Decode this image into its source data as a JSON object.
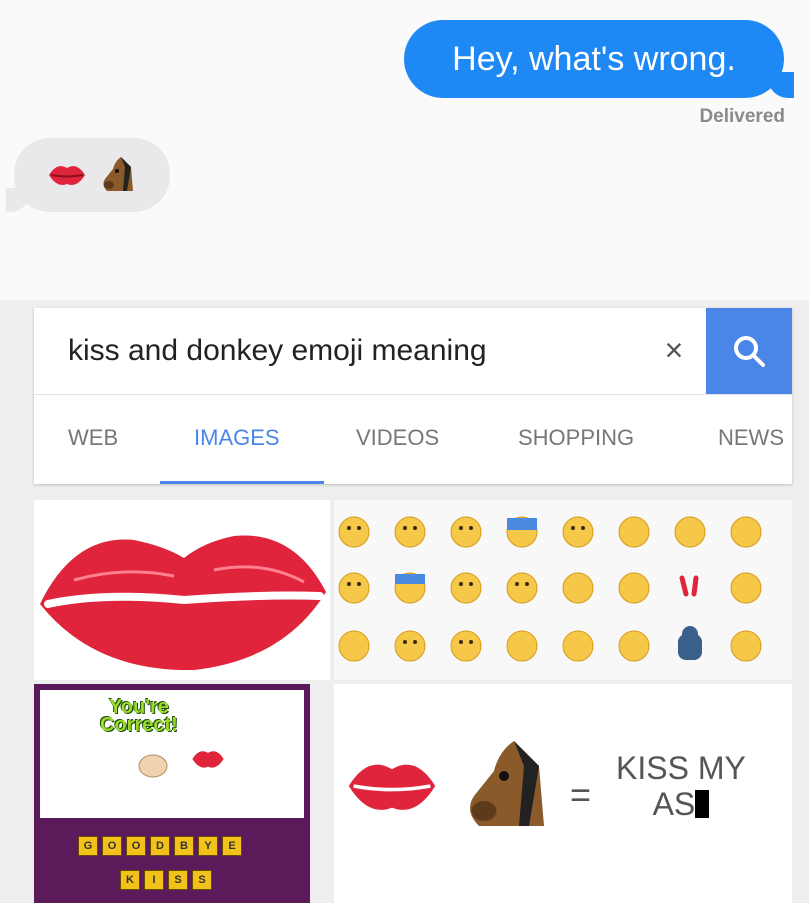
{
  "messages": {
    "outgoing_text": "Hey, what's wrong.",
    "delivered_label": "Delivered",
    "incoming_emojis": [
      "kiss-mark",
      "horse-face"
    ]
  },
  "search": {
    "query": "kiss and donkey emoji meaning",
    "clear_label": "×",
    "tabs": [
      "WEB",
      "IMAGES",
      "VIDEOS",
      "SHOPPING",
      "NEWS"
    ],
    "active_tab": "IMAGES"
  },
  "results": {
    "game_title_line1": "You're",
    "game_title_line2": "Correct!",
    "game_tiles_row1": [
      "G",
      "O",
      "O",
      "D",
      "B",
      "Y",
      "E"
    ],
    "game_tiles_row2": [
      "K",
      "I",
      "S",
      "S"
    ],
    "equation_equals": "=",
    "equation_text_line1": "KISS MY",
    "equation_text_line2": "AS"
  },
  "colors": {
    "imessage_blue": "#1e88f5",
    "google_blue": "#4a86e8"
  }
}
